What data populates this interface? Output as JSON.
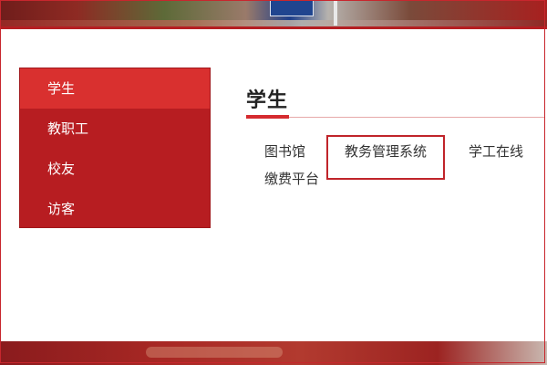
{
  "sidebar": {
    "items": [
      {
        "label": "学生",
        "active": true
      },
      {
        "label": "教职工",
        "active": false
      },
      {
        "label": "校友",
        "active": false
      },
      {
        "label": "访客",
        "active": false
      }
    ]
  },
  "main": {
    "title": "学生",
    "links": [
      {
        "label": "图书馆"
      },
      {
        "label": "教务管理系统",
        "highlighted": true
      },
      {
        "label": "学工在线"
      },
      {
        "label": "缴费平台"
      }
    ]
  },
  "colors": {
    "accent": "#b71d21",
    "active_item": "#d9302f",
    "highlight_border": "#c0242a"
  }
}
